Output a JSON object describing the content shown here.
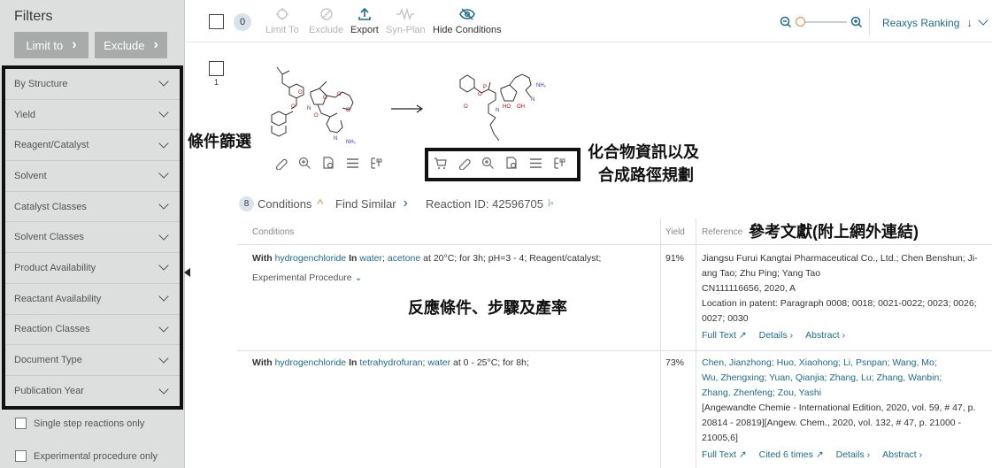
{
  "sidebar": {
    "title": "Filters",
    "limit_label": "Limit to",
    "exclude_label": "Exclude",
    "items": [
      "By Structure",
      "Yield",
      "Reagent/Catalyst",
      "Solvent",
      "Catalyst Classes",
      "Solvent Classes",
      "Product Availability",
      "Reactant Availability",
      "Reaction Classes",
      "Document Type",
      "Publication Year"
    ],
    "checkboxes": [
      "Single step reactions only",
      "Experimental procedure only"
    ]
  },
  "toolbar": {
    "selected_count": "0",
    "buttons": [
      "Limit To",
      "Exclude",
      "Export",
      "Syn-Plan",
      "Hide Conditions"
    ],
    "ranking": "Reaxys Ranking"
  },
  "annotations": {
    "filter": "條件篩選",
    "compound_line1": "化合物資訊以及",
    "compound_line2": "合成路徑規劃",
    "reference": "參考文獻(附上網外連結)",
    "conditions": "反應條件、步驟及產率"
  },
  "reaction": {
    "number": "1",
    "conditions_count": "8",
    "conditions_label": "Conditions",
    "find_similar": "Find Similar",
    "reaction_id": "Reaction ID: 42596705"
  },
  "table": {
    "col_conditions": "Conditions",
    "col_yield": "Yield",
    "col_reference": "Reference",
    "rows": [
      {
        "cond_with": "With",
        "cond_reagent": "hydrogenchloride",
        "cond_in": "In",
        "cond_solvent1": "water",
        "cond_sep": ";",
        "cond_solvent2": "acetone",
        "cond_rest": " at 20°C; for 3h; pH=3 - 4; Reagent/catalyst;",
        "exp_proc": "Experimental Procedure",
        "yield": "91%",
        "ref_line1": "Jiangsu Furui Kangtai Pharmaceutical Co., Ltd.; Chen Benshun; Ji-",
        "ref_line2": "ang Tao; Zhu Ping; Yang Tao",
        "ref_line3": "CN111116656, 2020, A",
        "ref_line4": "Location in patent: Paragraph 0008; 0018; 0021-0022; 0023; 0026;",
        "ref_line5": "0027; 0030",
        "full_text": "Full Text",
        "details": "Details",
        "abstract": "Abstract"
      },
      {
        "cond_with": "With",
        "cond_reagent": "hydrogenchloride",
        "cond_in": "In",
        "cond_solvent1": "tetrahydrofuran",
        "cond_sep": ";",
        "cond_solvent2": "water",
        "cond_rest": " at 0 - 25°C; for 8h;",
        "yield": "73%",
        "authors1": "Chen, Jianzhong; Huo, Xiaohong; Li, Psnpan; Wang, Mo;",
        "authors2": "Wu, Zhengxing; Yuan, Qianjia; Zhang, Lu; Zhang, Wanbin;",
        "authors3": "Zhang, Zhenfeng; Zou, Yashi",
        "ref_line1": "[Angewandte Chemie - International Edition, 2020, vol. 59, # 47, p.",
        "ref_line2": "20814 - 20819][Angew. Chem., 2020, vol. 132, # 47, p. 21000 -",
        "ref_line3": "21005,6]",
        "full_text": "Full Text",
        "cited": "Cited 6 times",
        "details": "Details",
        "abstract": "Abstract"
      }
    ]
  }
}
